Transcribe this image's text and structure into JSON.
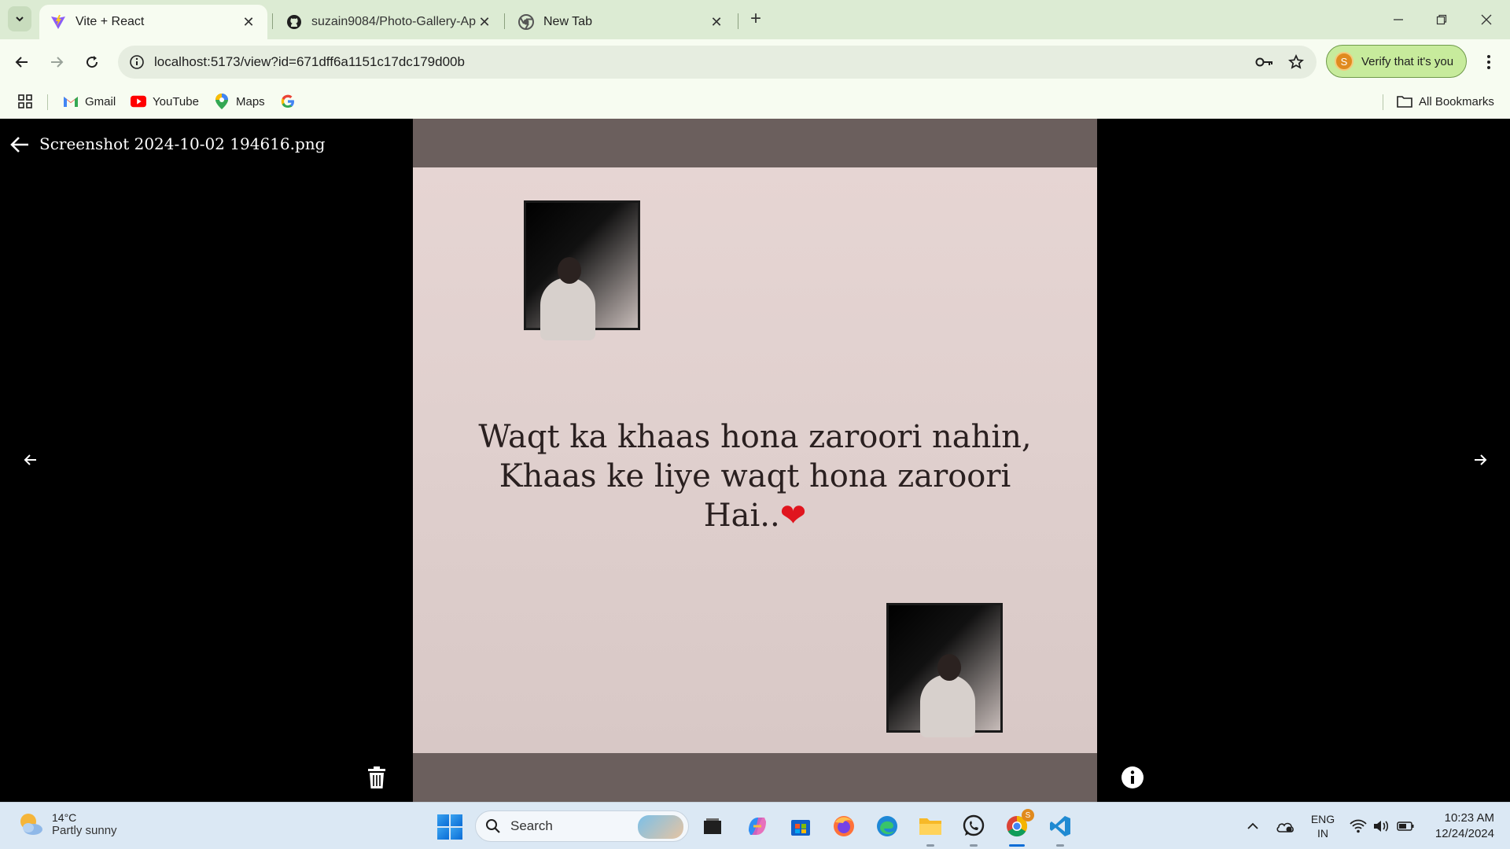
{
  "browser": {
    "tabs": [
      {
        "title": "Vite + React",
        "icon": "vite-icon",
        "active": true
      },
      {
        "title": "suzain9084/Photo-Gallery-App",
        "icon": "github-icon",
        "active": false
      },
      {
        "title": "New Tab",
        "icon": "chrome-icon",
        "active": false
      }
    ],
    "close_glyph": "✕",
    "new_tab_glyph": "+",
    "url": "localhost:5173/view?id=671dff6a1151c17dc179d00b",
    "verify_label": "Verify that it's you",
    "avatar_letter": "S",
    "bookmarks": [
      {
        "label": "Gmail",
        "icon": "gmail-icon"
      },
      {
        "label": "YouTube",
        "icon": "youtube-icon"
      },
      {
        "label": "Maps",
        "icon": "maps-icon"
      },
      {
        "label": "",
        "icon": "google-icon"
      }
    ],
    "all_bookmarks_label": "All Bookmarks"
  },
  "viewer": {
    "file_name": "Screenshot 2024-10-02 194616.png",
    "quote_lines": [
      "Waqt ka khaas hona zaroori nahin,",
      "Khaas ke liye waqt hona zaroori",
      "Hai.."
    ],
    "heart": "❤"
  },
  "taskbar": {
    "weather_temp": "14°C",
    "weather_condition": "Partly sunny",
    "search_placeholder": "Search",
    "language": "ENG",
    "region": "IN",
    "time": "10:23 AM",
    "date": "12/24/2024",
    "notification_badge": "S"
  },
  "colors": {
    "tabstrip": "#dcebd3",
    "toolbar": "#f7fcf1",
    "verify_bg": "#c7eb9c",
    "viewer_bg": "#000000",
    "taskbar": "#dbe8f4"
  }
}
